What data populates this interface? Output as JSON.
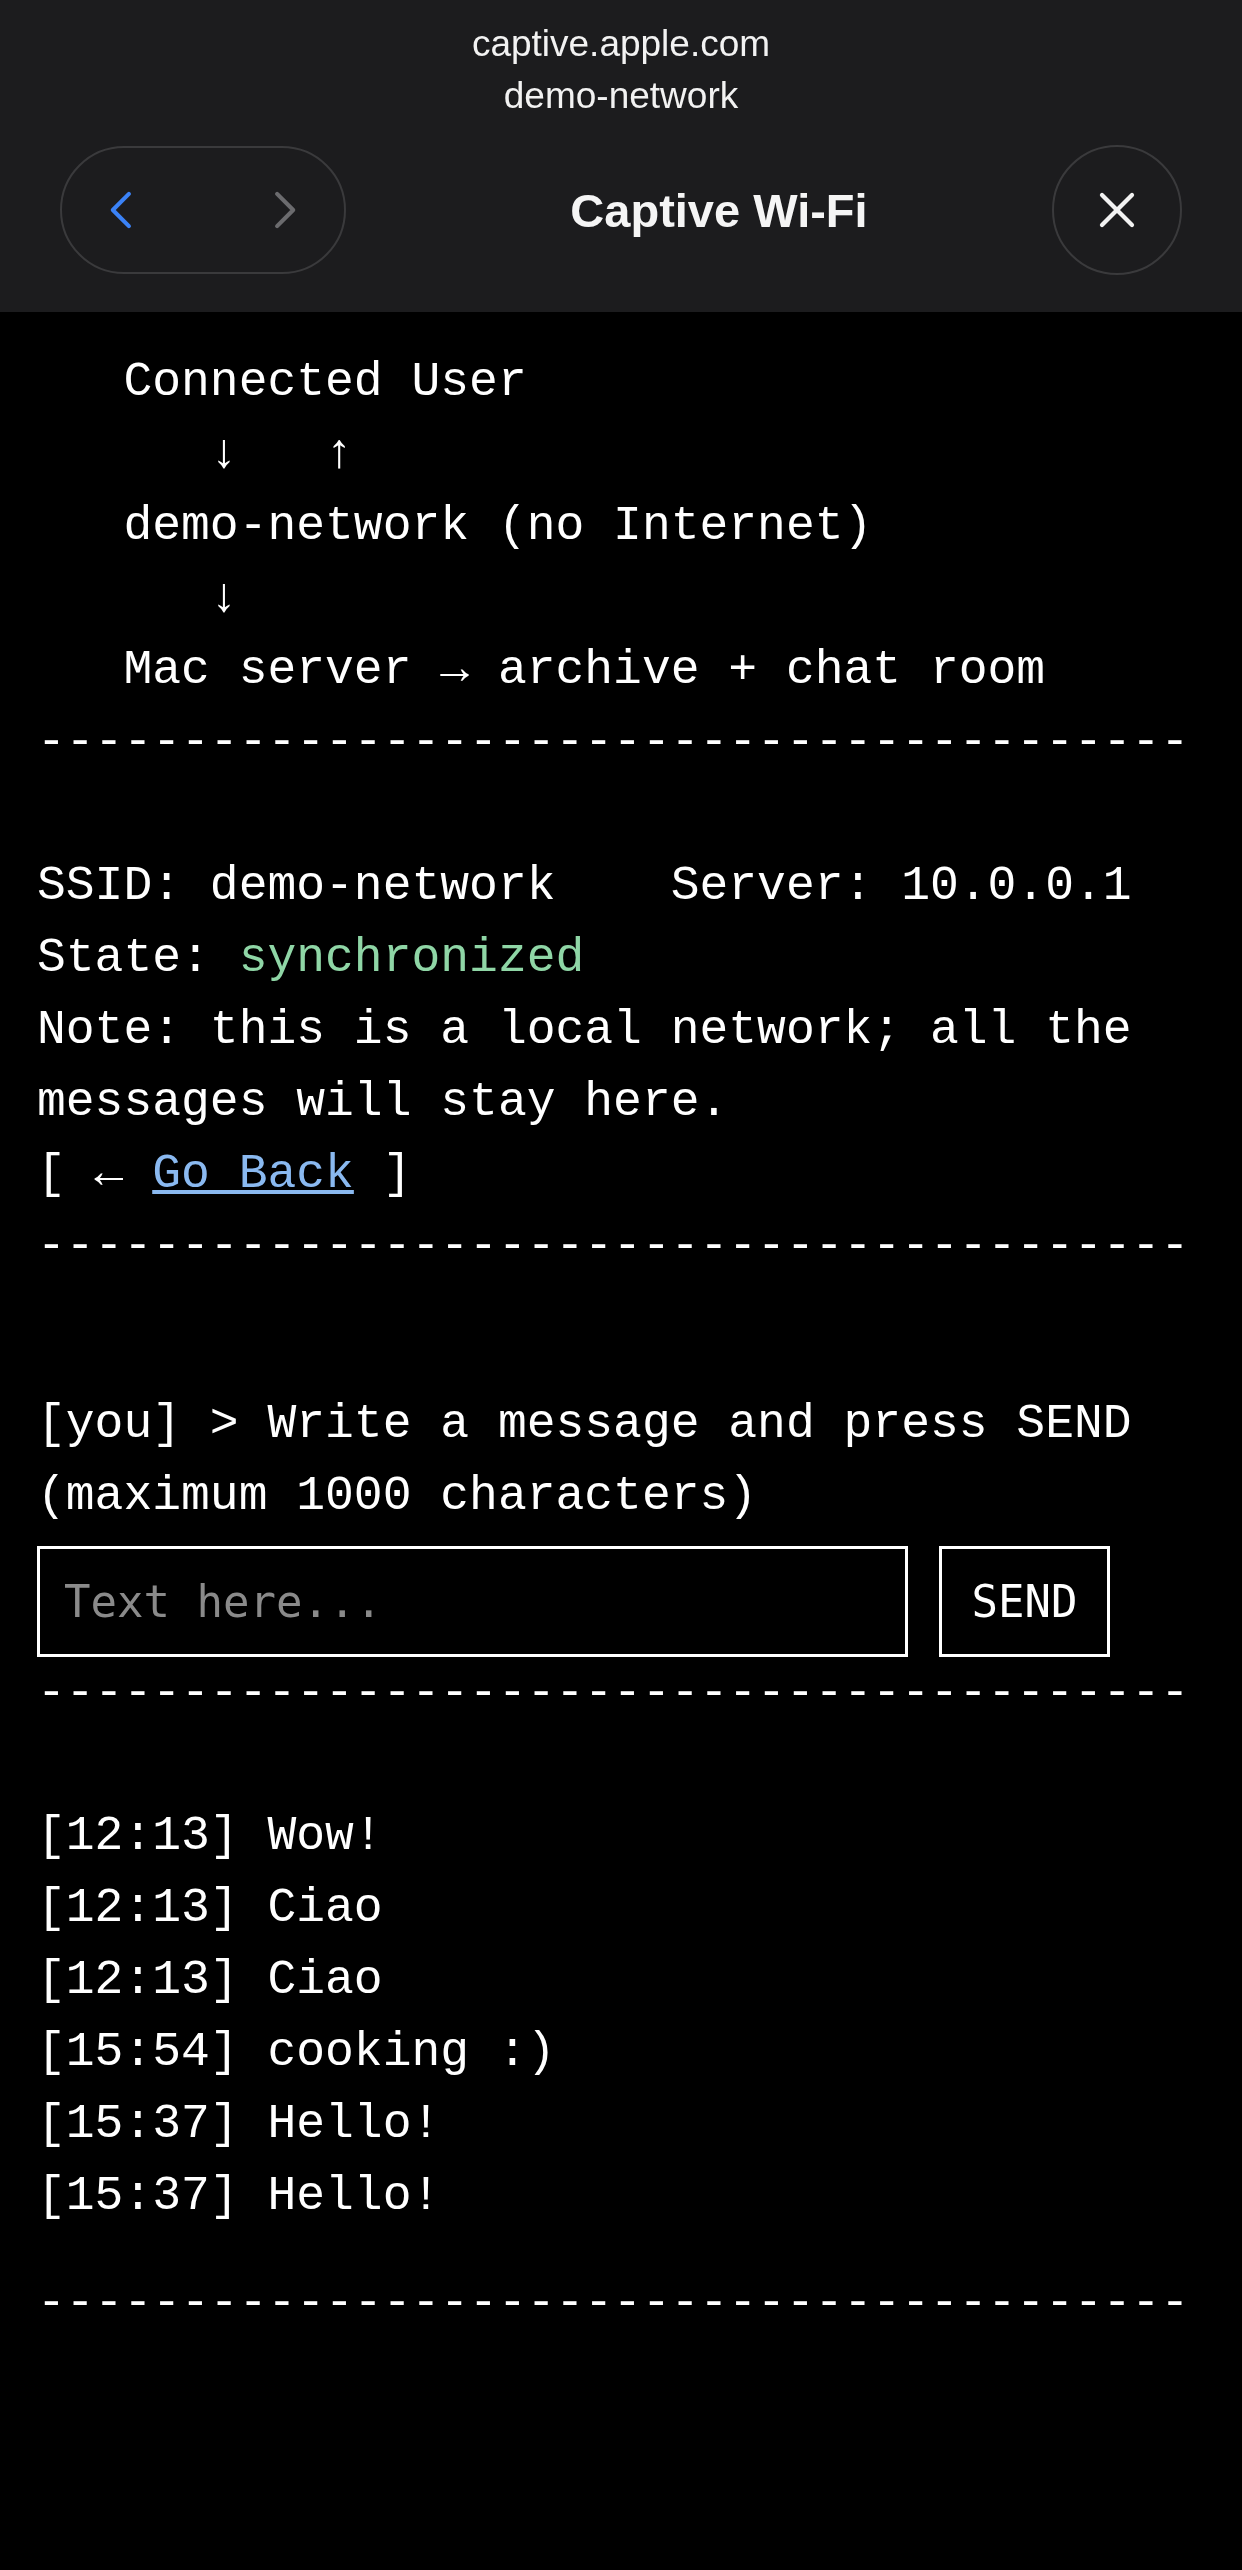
{
  "browser": {
    "url": "captive.apple.com",
    "network": "demo-network",
    "title": "Captive Wi-Fi",
    "back_enabled": true,
    "forward_enabled": false
  },
  "diagram": {
    "lines": [
      "   Connected User",
      "      ↓   ↑",
      "   demo-network (no Internet)",
      "      ↓",
      "   Mac server → archive + chat room"
    ],
    "rule": "----------------------------------------"
  },
  "info": {
    "network_line": "SSID: demo-network    Server: 10.0.0.1",
    "state_label": "State:",
    "state_value": "synchronized",
    "note": "Note: this is a local network; all the messages will stay here.",
    "back_prefix": "[ ←",
    "back_link": "Go Back",
    "back_suffix": "]",
    "rule": "----------------------------------------"
  },
  "compose": {
    "prompt": "[you] > Write a message and press SEND (maximum 1000 characters)",
    "placeholder": "Text here...",
    "button": "SEND",
    "rule": "----------------------------------------"
  },
  "messages": [
    {
      "time": "[12:13]",
      "text": "Wow!"
    },
    {
      "time": "[12:13]",
      "text": "Ciao"
    },
    {
      "time": "[12:13]",
      "text": "Ciao"
    },
    {
      "time": "[15:54]",
      "text": "cooking :)"
    },
    {
      "time": "[15:37]",
      "text": "Hello!"
    },
    {
      "time": "[15:37]",
      "text": "Hello!"
    }
  ],
  "messages_rule": "----------------------------------------"
}
